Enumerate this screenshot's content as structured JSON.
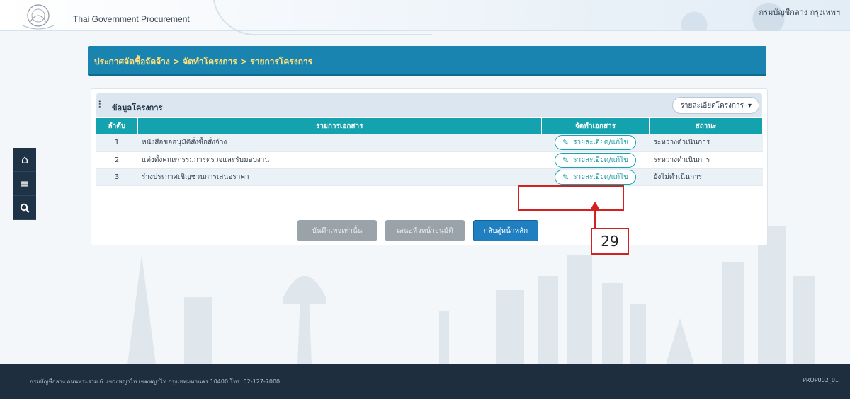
{
  "header": {
    "site_title": "Thai Government Procurement",
    "user_link": "กรมบัญชีกลาง กรุงเทพฯ"
  },
  "side_tools": [
    {
      "icon": "home-icon",
      "glyph": "⌂"
    },
    {
      "icon": "menu-icon",
      "glyph": "≡"
    },
    {
      "icon": "search-icon",
      "glyph": "⚲"
    }
  ],
  "breadcrumb": "ประกาศจัดซื้อจัดจ้าง > จัดทำโครงการ > รายการโครงการ",
  "panel": {
    "title": "ข้อมูลโครงการ",
    "dropdown_label": "รายละเอียดโครงการ",
    "columns": [
      "ลำดับ",
      "รายการเอกสาร",
      "จัดทำเอกสาร",
      "สถานะ"
    ],
    "rows": [
      {
        "no": "1",
        "document": "หนังสือขออนุมัติสั่งซื้อสั่งจ้าง",
        "action": "รายละเอียด/แก้ไข",
        "status": "ระหว่างดำเนินการ"
      },
      {
        "no": "2",
        "document": "แต่งตั้งคณะกรรมการตรวจและรับมอบงาน",
        "action": "รายละเอียด/แก้ไข",
        "status": "ระหว่างดำเนินการ"
      },
      {
        "no": "3",
        "document": "ร่างประกาศเชิญชวนการเสนอราคา",
        "action": "รายละเอียด/แก้ไข",
        "status": "ยังไม่ดำเนินการ"
      }
    ],
    "buttons": {
      "save": "บันทึกเพจเท่านั้น",
      "approve": "เสนอหัวหน้าอนุมัติ",
      "back": "กลับสู่หน้าหลัก"
    }
  },
  "annotation": {
    "step_number": "29",
    "color": "#d32020"
  },
  "footer": {
    "address": "กรมบัญชีกลาง ถนนพระราม 6 แขวงพญาไท เขตพญาไท กรุงเทพมหานคร 10400 โทร. 02-127-7000",
    "page_code": "PROP002_01"
  },
  "colors": {
    "breadcrumb_bg": "#1a84b0",
    "table_header": "#14a3ae",
    "footer_bg": "#1e2e3e",
    "primary_button": "#1f7fc1"
  }
}
